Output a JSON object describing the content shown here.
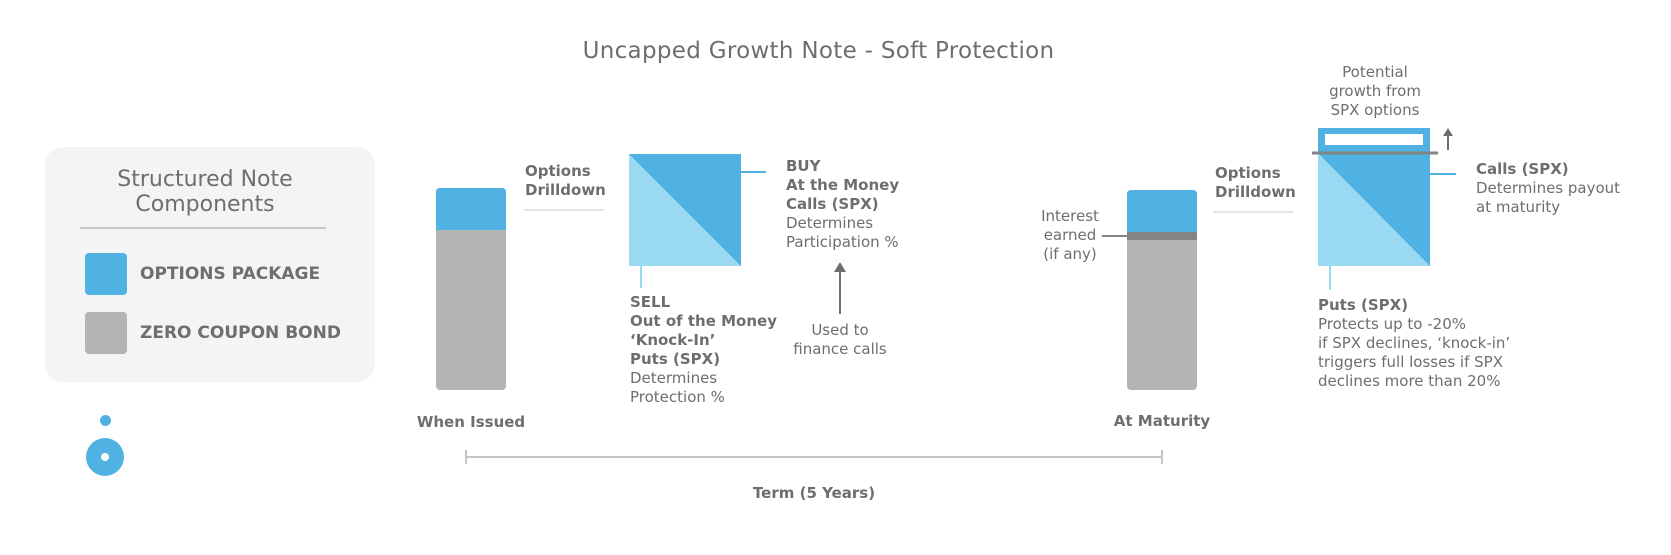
{
  "title": "Uncapped Growth Note - Soft Protection",
  "colors": {
    "options_blue": "#50b2e3",
    "options_light_blue": "#99d9f2",
    "bond_gray": "#b3b4b4",
    "interest_gray": "#838486",
    "text_gray": "#6d6e70",
    "legend_bg": "#f3f4f6"
  },
  "legend": {
    "title_line1": "Structured Note",
    "title_line2": "Components",
    "items": [
      {
        "label": "OPTIONS PACKAGE",
        "color": "#50b2e3"
      },
      {
        "label": "ZERO COUPON BOND",
        "color": "#b3b4b4"
      }
    ]
  },
  "loader_icon": "loading-spinner-icon",
  "issued": {
    "label": "When Issued",
    "drilldown_line1": "Options",
    "drilldown_line2": "Drilldown",
    "buy": {
      "action": "BUY",
      "line1": "At the Money",
      "line2": "Calls (SPX)",
      "desc1": "Determines",
      "desc2": "Participation %"
    },
    "sell": {
      "action": "SELL",
      "line1": "Out of the Money",
      "line2": "‘Knock-In’",
      "line3": "Puts (SPX)",
      "desc1": "Determines",
      "desc2": "Protection %"
    },
    "finance_note_line1": "Used to",
    "finance_note_line2": "finance calls"
  },
  "maturity": {
    "label": "At Maturity",
    "interest_line1": "Interest",
    "interest_line2": "earned",
    "interest_line3": "(if any)",
    "drilldown_line1": "Options",
    "drilldown_line2": "Drilldown",
    "growth_line1": "Potential",
    "growth_line2": "growth from",
    "growth_line3": "SPX options",
    "calls": {
      "title": "Calls (SPX)",
      "desc1": "Determines payout",
      "desc2": "at maturity"
    },
    "puts": {
      "title": "Puts (SPX)",
      "desc1": "Protects up to -20%",
      "desc2": "if SPX declines, ‘knock-in’",
      "desc3": "triggers full losses if SPX",
      "desc4": "declines more than 20%"
    }
  },
  "term": {
    "label": "Term (5 Years)"
  }
}
